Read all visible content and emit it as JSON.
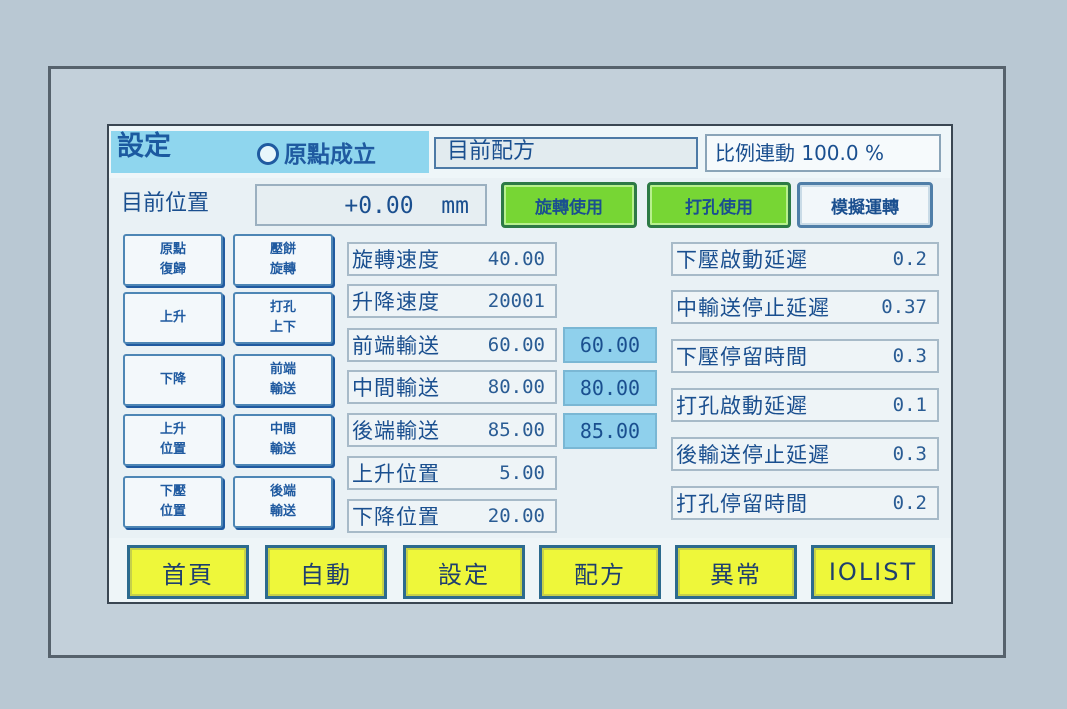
{
  "header": {
    "title": "設定",
    "origin_status": "原點成立",
    "current_recipe_label": "目前配方",
    "ratio_label": "比例連動 100.0 %"
  },
  "position": {
    "label": "目前位置",
    "value": "+0.00",
    "unit": "mm"
  },
  "modes": {
    "rotate": "旋轉使用",
    "punch": "打孔使用",
    "simulate": "模擬運轉"
  },
  "commands": [
    {
      "label": "原點\n復歸"
    },
    {
      "label": "壓餅\n旋轉"
    },
    {
      "label": "上升"
    },
    {
      "label": "打孔\n上下"
    },
    {
      "label": "下降"
    },
    {
      "label": "前端\n輸送"
    },
    {
      "label": "上升\n位置"
    },
    {
      "label": "中間\n輸送"
    },
    {
      "label": "下壓\n位置"
    },
    {
      "label": "後端\n輸送"
    }
  ],
  "params": [
    {
      "label": "旋轉速度",
      "value": "40.00"
    },
    {
      "label": "升降速度",
      "value": "20001"
    },
    {
      "label": "前端輸送",
      "value": "60.00",
      "actual": "60.00"
    },
    {
      "label": "中間輸送",
      "value": "80.00",
      "actual": "80.00"
    },
    {
      "label": "後端輸送",
      "value": "85.00",
      "actual": "85.00"
    },
    {
      "label": "上升位置",
      "value": "5.00"
    },
    {
      "label": "下降位置",
      "value": "20.00"
    }
  ],
  "timers": [
    {
      "label": "下壓啟動延遲",
      "value": "0.2"
    },
    {
      "label": "中輸送停止延遲",
      "value": "0.37"
    },
    {
      "label": "下壓停留時間",
      "value": "0.3"
    },
    {
      "label": "打孔啟動延遲",
      "value": "0.1"
    },
    {
      "label": "後輸送停止延遲",
      "value": "0.3"
    },
    {
      "label": "打孔停留時間",
      "value": "0.2"
    }
  ],
  "nav": {
    "home": "首頁",
    "auto": "自動",
    "settings": "設定",
    "recipe": "配方",
    "alarm": "異常",
    "iolist": "IOLIST"
  },
  "colors": {
    "screen_bg": "#e9f1f5",
    "title_bar": "#8fd6ee",
    "text_blue": "#1a4f8f",
    "nav_yellow": "#eef73a",
    "mode_green": "#77d634",
    "actual_value_bg": "#8fd0ec"
  }
}
